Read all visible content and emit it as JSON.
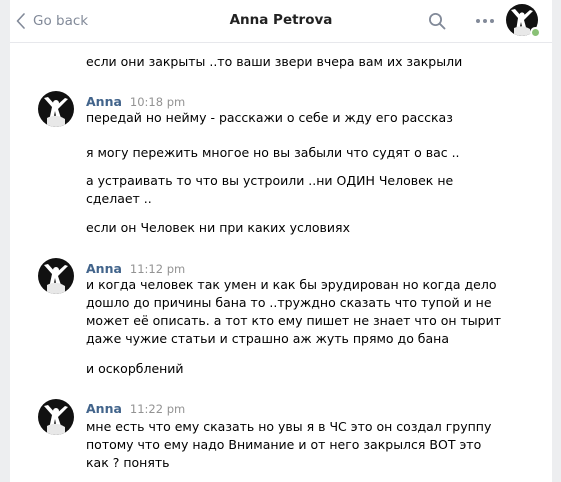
{
  "header": {
    "back_label": "Go back",
    "title": "Anna Petrova",
    "icons": [
      "chevron-left-icon",
      "search-icon",
      "more-icon",
      "avatar-icon"
    ],
    "online_color": "#8ac176"
  },
  "messages": [
    {
      "author": "",
      "time": "",
      "lines": [
        "если они закрыты ..то ваши звери вчера вам их закрыли"
      ]
    },
    {
      "author": "Anna",
      "time": "10:18 pm",
      "lines": [
        "передай но нейму - расскажи о себе и жду его рассказ",
        "я могу пережить многое но вы забыли что судят о вас ..",
        "а устраивать то что вы устроили ..ни ОДИН Человек не",
        "сделает ..",
        "если он Человек ни при каких условиях"
      ]
    },
    {
      "author": "Anna",
      "time": "11:12 pm",
      "lines": [
        "и когда человек так умен и как бы эрудирован но когда дело",
        "дошло до причины бана то ..труждно сказать что тупой и не",
        "может её описать. а тот кто ему пишет не знает что он тырит",
        "даже чужие статьи и страшно аж жуть прямо до бана",
        "и оскорблений"
      ]
    },
    {
      "author": "Anna",
      "time": "11:22 pm",
      "lines": [
        "мне есть что ему сказать но увы я в ЧС это он создал группу",
        "потому что ему надо Внимание и от него закрылся ВОТ это",
        "как ? понять"
      ]
    }
  ],
  "colors": {
    "author": "#42648b",
    "time": "#939393",
    "muted": "#828a99"
  }
}
